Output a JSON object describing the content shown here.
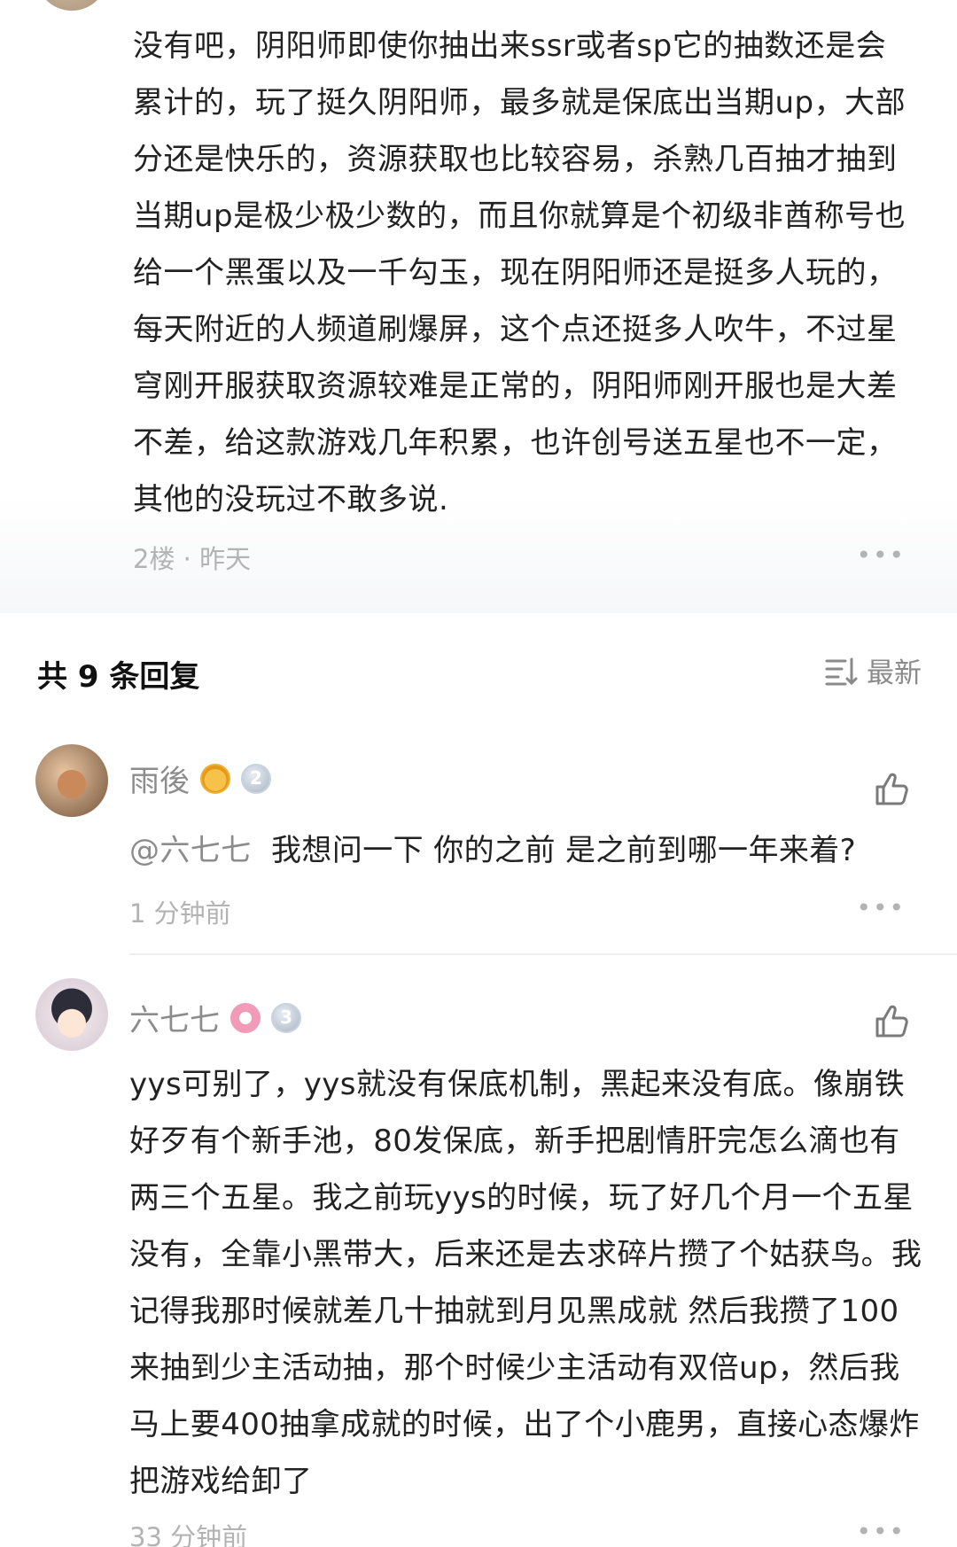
{
  "main_post": {
    "text": "没有吧，阴阳师即使你抽出来ssr或者sp它的抽数还是会累计的，玩了挺久阴阳师，最多就是保底出当期up，大部分还是快乐的，资源获取也比较容易，杀熟几百抽才抽到当期up是极少极少数的，而且你就算是个初级非酋称号也给一个黑蛋以及一千勾玉，现在阴阳师还是挺多人玩的，每天附近的人频道刷爆屏，这个点还挺多人吹牛，不过星穹刚开服获取资源较难是正常的，阴阳师刚开服也是大差不差，给这款游戏几年积累，也许创号送五星也不一定，其他的没玩过不敢多说.",
    "meta": "2楼 · 昨天"
  },
  "replies_section": {
    "title": "共 9 条回复",
    "sort_label": "最新"
  },
  "replies": [
    {
      "username": "雨後",
      "level": "2",
      "mention": "@六七七",
      "text": "我想问一下 你的之前 是之前到哪一年来着?",
      "time": "1 分钟前"
    },
    {
      "username": "六七七",
      "level": "3",
      "text": "yys可别了，yys就没有保底机制，黑起来没有底。像崩铁好歹有个新手池，80发保底，新手把剧情肝完怎么滴也有两三个五星。我之前玩yys的时候，玩了好几个月一个五星没有，全靠小黑带大，后来还是去求碎片攒了个姑获鸟。我记得我那时候就差几十抽就到月见黑成就 然后我攒了100来抽到少主活动抽，那个时候少主活动有双倍up，然后我马上要400抽拿成就的时候，出了个小鹿男，直接心态爆炸把游戏给卸了",
      "time": "33 分钟前"
    }
  ]
}
